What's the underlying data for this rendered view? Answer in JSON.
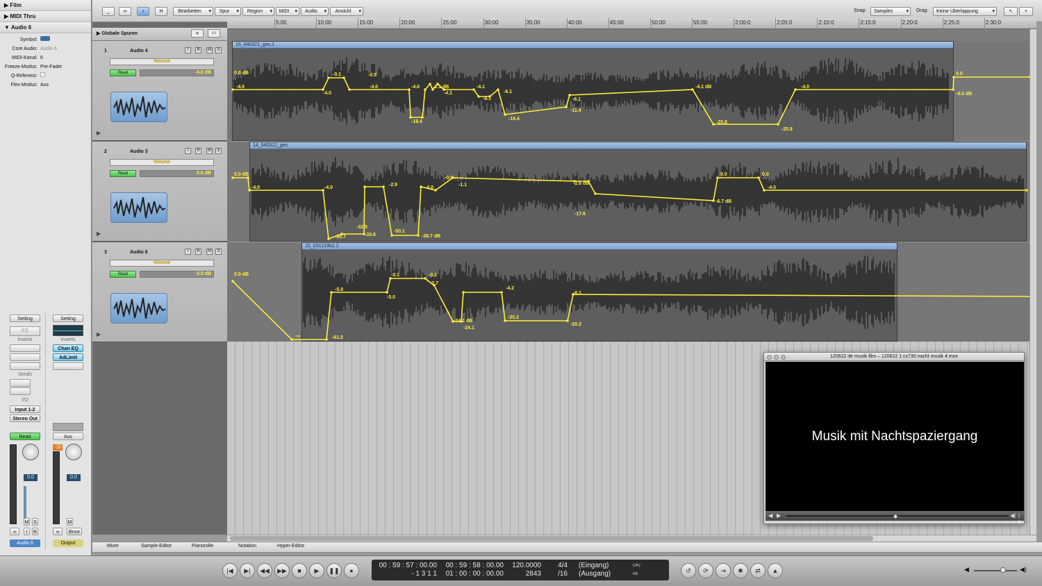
{
  "inspector": {
    "sections": [
      "Film",
      "MIDI Thru",
      "Audio 6"
    ],
    "fields": [
      {
        "k": "Symbol:",
        "v": ""
      },
      {
        "k": "Core Audio:",
        "v": "Audio 6"
      },
      {
        "k": "MIDI-Kanal:",
        "v": "6"
      },
      {
        "k": "Freeze-Modus:",
        "v": "Pre-Fader"
      },
      {
        "k": "Q-Referenz:",
        "v": ""
      },
      {
        "k": "Flex-Modus:",
        "v": "Aus"
      }
    ],
    "strip_left": {
      "setting": "Setting",
      "eq": "EQ",
      "inserts": "Inserts",
      "sends": "Sends",
      "io": "I/O",
      "input": "Input 1-2",
      "output": "Stereo Out",
      "mode": "Read",
      "pan": "0.0",
      "name": "Audio 6",
      "m": "M",
      "s": "S",
      "i": "I",
      "r": "R"
    },
    "strip_right": {
      "setting": "Setting",
      "inserts": "Inserts",
      "ins1": "Chan EQ",
      "ins2": "AdLimit",
      "mode": "Aus",
      "peak": "-16",
      "pan": "0.0",
      "name": "Output",
      "m": "M",
      "bnce": "Bnce"
    }
  },
  "toolbar": {
    "menus": [
      "Bearbeiten",
      "Spur",
      "Region",
      "MIDI",
      "Audio",
      "Ansicht"
    ],
    "h_label": "H",
    "snap_label": "Snap:",
    "snap_value": "Samples",
    "drag_label": "Drag:",
    "drag_value": "Keine Überlappung"
  },
  "global_tracks": "Globale Spuren",
  "ruler": [
    "5:00",
    "10:00",
    "15:00",
    "20:00",
    "25:00",
    "30:00",
    "35:00",
    "40:00",
    "45:00",
    "50:00",
    "55:00",
    "2:00:0",
    "2:05:0",
    "2:10:0",
    "2:15:0",
    "2:20:0",
    "2:25:0",
    "2:30:0"
  ],
  "tracks": [
    {
      "num": "1",
      "name": "Audio 4",
      "param": "Volume",
      "mode": "Read",
      "vol": "-4.0 dB",
      "region": "16_040321_ges.1",
      "labels": [
        "0.0 dB",
        "-4.0",
        "-4.0",
        "-0.1",
        "-0.5",
        "-4.0",
        "-4.0",
        "-18.4",
        "-1.1 dB",
        "-4.1",
        "-4.1",
        "-6.1",
        "-6.1",
        "-16.4",
        "-6.1",
        "-11.4",
        "-4.1 dB",
        "-25.8",
        "-25.8",
        "-4.0",
        "0.0",
        "-4.0 dB"
      ]
    },
    {
      "num": "2",
      "name": "Audio 3",
      "param": "Volume",
      "mode": "Read",
      "vol": "0.0 dB",
      "region": "14_040312_ges",
      "labels": [
        "0.0 dB",
        "-4.0",
        "-4.0",
        "-90.7",
        "-32.5",
        "-33.6",
        "-2.9",
        "-50.1",
        "-4.0",
        "-38.7 dB",
        "-0.9",
        "-1.1",
        "-2.6 dB",
        "-17.6",
        "-6.7 dB",
        "0.0",
        "0.0",
        "-4.0"
      ]
    },
    {
      "num": "3",
      "name": "Audio 6",
      "param": "Volume",
      "mode": "Read",
      "vol": "0.0 dB",
      "region": "15_031219b2.2",
      "labels": [
        "0.0 dB",
        "-∞",
        "-61.0",
        "-5.0",
        "-5.0",
        "-0.1",
        "-0.1",
        "-2.7",
        "-24.1 dB",
        "-24.1",
        "-4.2",
        "-20.2",
        "-6.1",
        "-20.2"
      ]
    }
  ],
  "movie": {
    "title": "120622 de musik film – 120622 1 cx730 nacht musik 4.mov",
    "text": "Musik mit Nachtspaziergang"
  },
  "tabs": [
    "Mixer",
    "Sample-Editor",
    "Pianorolle",
    "Notation",
    "Hyper-Editor"
  ],
  "transport": {
    "smpte": "00 : 59 : 57 : 00.00",
    "bars": "-      1     3     1     1",
    "smpte2": "00 : 59 : 58 : 00.00",
    "smpte3": "01 : 00 : 00 : 00.00",
    "tempo": "120.0000",
    "samples": "2843",
    "sig": "4/4",
    "div": "/16",
    "in": "(Eingang)",
    "out": "(Ausgang)",
    "cpu": "CPU",
    "hd": "HD"
  },
  "colors": {
    "automation": "#ffef3a",
    "region_header": "#8eb0da",
    "read_green": "#5cc95c"
  }
}
